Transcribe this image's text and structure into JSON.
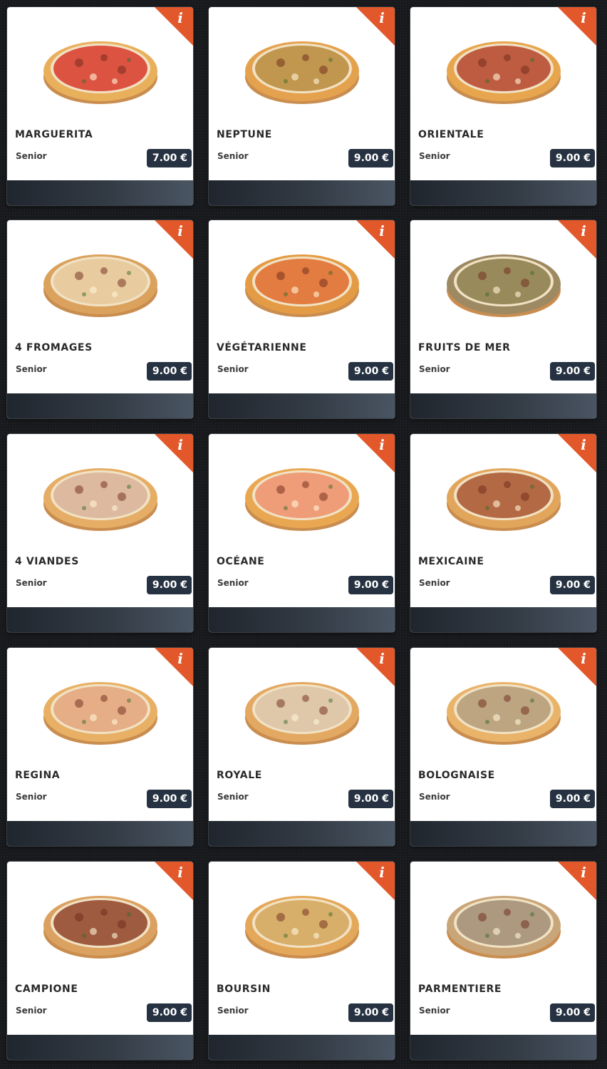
{
  "colors": {
    "accent": "#e2582a",
    "price_badge": "#263241",
    "footer": "#2f3742",
    "background": "#17191c"
  },
  "info_icon": {
    "name": "info-icon",
    "glyph": "i"
  },
  "products": [
    {
      "name": "MARGUERITA",
      "size": "Senior",
      "price": "7.00 €",
      "topping": "#d93a2b",
      "crust": "#e9b05c"
    },
    {
      "name": "NEPTUNE",
      "size": "Senior",
      "price": "9.00 €",
      "topping": "#b98a3b",
      "crust": "#e4a24f"
    },
    {
      "name": "ORIENTALE",
      "size": "Senior",
      "price": "9.00 €",
      "topping": "#b5442c",
      "crust": "#e7a64e"
    },
    {
      "name": "4 FROMAGES",
      "size": "Senior",
      "price": "9.00 €",
      "topping": "#e8c79a",
      "crust": "#dba25e"
    },
    {
      "name": "VÉGÉTARIENNE",
      "size": "Senior",
      "price": "9.00 €",
      "topping": "#e06a2a",
      "crust": "#e49b45"
    },
    {
      "name": "FRUITS DE MER",
      "size": "Senior",
      "price": "9.00 €",
      "topping": "#8a7a4a",
      "crust": "#9d8a63"
    },
    {
      "name": "4 VIANDES",
      "size": "Senior",
      "price": "9.00 €",
      "topping": "#d9b199",
      "crust": "#e5ad65"
    },
    {
      "name": "OCÉANE",
      "size": "Senior",
      "price": "9.00 €",
      "topping": "#ef8f6c",
      "crust": "#e9a752"
    },
    {
      "name": "MEXICAINE",
      "size": "Senior",
      "price": "9.00 €",
      "topping": "#a9542f",
      "crust": "#e2a55c"
    },
    {
      "name": "REGINA",
      "size": "Senior",
      "price": "9.00 €",
      "topping": "#e3a57c",
      "crust": "#e8b064"
    },
    {
      "name": "ROYALE",
      "size": "Senior",
      "price": "9.00 €",
      "topping": "#dcc2a6",
      "crust": "#e3a861"
    },
    {
      "name": "BOLOGNAISE",
      "size": "Senior",
      "price": "9.00 €",
      "topping": "#b49a77",
      "crust": "#e9b36a"
    },
    {
      "name": "CAMPIONE",
      "size": "Senior",
      "price": "9.00 €",
      "topping": "#8f4328",
      "crust": "#dba160"
    },
    {
      "name": "BOURSIN",
      "size": "Senior",
      "price": "9.00 €",
      "topping": "#d4a45c",
      "crust": "#e4a85a"
    },
    {
      "name": "PARMENTIERE",
      "size": "Senior",
      "price": "9.00 €",
      "topping": "#a08c74",
      "crust": "#c9a57a"
    }
  ]
}
